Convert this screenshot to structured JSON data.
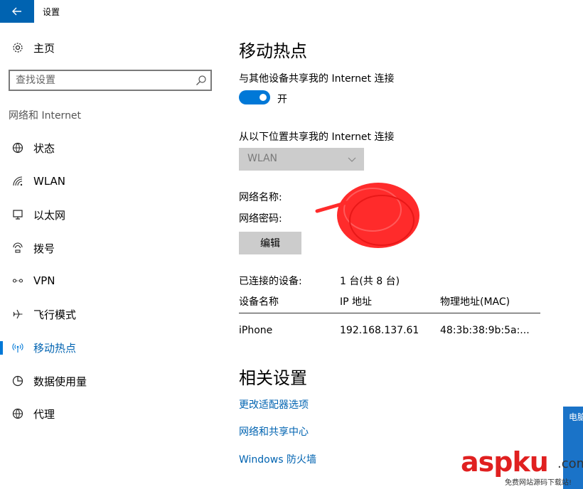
{
  "window": {
    "title": "设置"
  },
  "sidebar": {
    "home_label": "主页",
    "search_placeholder": "查找设置",
    "group_label": "网络和 Internet",
    "items": [
      {
        "label": "状态",
        "icon": "globe-status-icon"
      },
      {
        "label": "WLAN",
        "icon": "wifi-icon"
      },
      {
        "label": "以太网",
        "icon": "ethernet-icon"
      },
      {
        "label": "拨号",
        "icon": "dialup-icon"
      },
      {
        "label": "VPN",
        "icon": "vpn-icon"
      },
      {
        "label": "飞行模式",
        "icon": "airplane-icon"
      },
      {
        "label": "移动热点",
        "icon": "hotspot-icon",
        "active": true
      },
      {
        "label": "数据使用量",
        "icon": "data-usage-icon"
      },
      {
        "label": "代理",
        "icon": "globe-icon"
      }
    ]
  },
  "main": {
    "title": "移动热点",
    "share_label": "与其他设备共享我的 Internet 连接",
    "toggle_state_label": "开",
    "share_from_label": "从以下位置共享我的 Internet 连接",
    "share_from_value": "WLAN",
    "network_name_label": "网络名称:",
    "network_password_label": "网络密码:",
    "edit_label": "编辑",
    "connected_label": "已连接的设备:",
    "connected_value": "1 台(共 8 台)",
    "table": {
      "headers": [
        "设备名称",
        "IP 地址",
        "物理地址(MAC)"
      ],
      "rows": [
        [
          "iPhone",
          "192.168.137.61",
          "48:3b:38:9b:5a:..."
        ]
      ]
    },
    "related_title": "相关设置",
    "links": [
      "更改适配器选项",
      "网络和共享中心",
      "Windows 防火墙"
    ]
  },
  "side_panel": {
    "text": "电脑"
  },
  "watermark": {
    "main": "aspku",
    "com": ".com",
    "sub": "免费网站源码下载站!"
  },
  "colors": {
    "accent": "#0078d7",
    "titlebar_back": "#0063b1",
    "redaction": "#ff2b2b"
  }
}
